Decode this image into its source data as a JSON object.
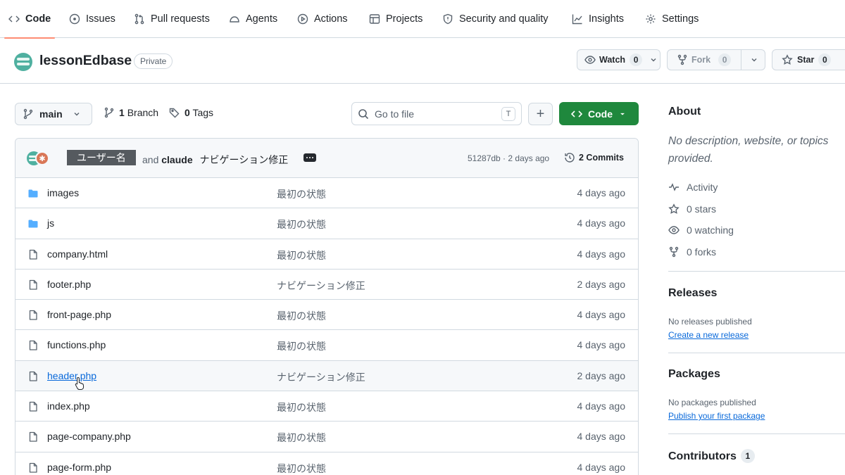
{
  "tabs": [
    {
      "label": "Code",
      "icon": "code-icon",
      "active": true
    },
    {
      "label": "Issues",
      "icon": "issue-opened-icon"
    },
    {
      "label": "Pull requests",
      "icon": "git-pull-request-icon"
    },
    {
      "label": "Agents",
      "icon": "agent-icon"
    },
    {
      "label": "Actions",
      "icon": "play-icon"
    },
    {
      "label": "Projects",
      "icon": "table-icon"
    },
    {
      "label": "Security and quality",
      "icon": "shield-icon"
    },
    {
      "label": "Insights",
      "icon": "graph-icon"
    },
    {
      "label": "Settings",
      "icon": "gear-icon"
    }
  ],
  "repo": {
    "name": "lessonEdbase",
    "visibility": "Private",
    "watch": {
      "label": "Watch",
      "count": "0"
    },
    "fork": {
      "label": "Fork",
      "count": "0"
    },
    "star": {
      "label": "Star",
      "count": "0"
    }
  },
  "toolbar": {
    "branch": "main",
    "branches_count": "1",
    "branches_label": "Branch",
    "tags_count": "0",
    "tags_label": "Tags",
    "search_placeholder": "Go to file",
    "search_shortcut": "T",
    "add_label": "+",
    "code_label": "Code"
  },
  "commit": {
    "user": "ユーザー名",
    "and": "and",
    "coauthor": "claude",
    "message": "ナビゲーション修正",
    "hash_time": "51287db · 2 days ago",
    "commits_label": "2 Commits"
  },
  "files": [
    {
      "name": "images",
      "type": "dir",
      "message": "最初の状態",
      "date": "4 days ago"
    },
    {
      "name": "js",
      "type": "dir",
      "message": "最初の状態",
      "date": "4 days ago"
    },
    {
      "name": "company.html",
      "type": "file",
      "message": "最初の状態",
      "date": "4 days ago"
    },
    {
      "name": "footer.php",
      "type": "file",
      "message": "ナビゲーション修正",
      "date": "2 days ago"
    },
    {
      "name": "front-page.php",
      "type": "file",
      "message": "最初の状態",
      "date": "4 days ago"
    },
    {
      "name": "functions.php",
      "type": "file",
      "message": "最初の状態",
      "date": "4 days ago"
    },
    {
      "name": "header.php",
      "type": "file",
      "message": "ナビゲーション修正",
      "date": "2 days ago",
      "hover": true
    },
    {
      "name": "index.php",
      "type": "file",
      "message": "最初の状態",
      "date": "4 days ago"
    },
    {
      "name": "page-company.php",
      "type": "file",
      "message": "最初の状態",
      "date": "4 days ago"
    },
    {
      "name": "page-form.php",
      "type": "file",
      "message": "最初の状態",
      "date": "4 days ago"
    }
  ],
  "about": {
    "title": "About",
    "description": "No description, website, or topics provided.",
    "activity": "Activity",
    "stars": "0 stars",
    "watching": "0 watching",
    "forks": "0 forks"
  },
  "releases": {
    "title": "Releases",
    "empty": "No releases published",
    "link": "Create a new release"
  },
  "packages": {
    "title": "Packages",
    "empty": "No packages published",
    "link": "Publish your first package"
  },
  "contributors": {
    "title": "Contributors",
    "count": "1"
  },
  "colors": {
    "accent_green": "#1f883d",
    "link_blue": "#0969da",
    "tab_underline": "#fd8c73",
    "folder_blue": "#54aeff"
  }
}
